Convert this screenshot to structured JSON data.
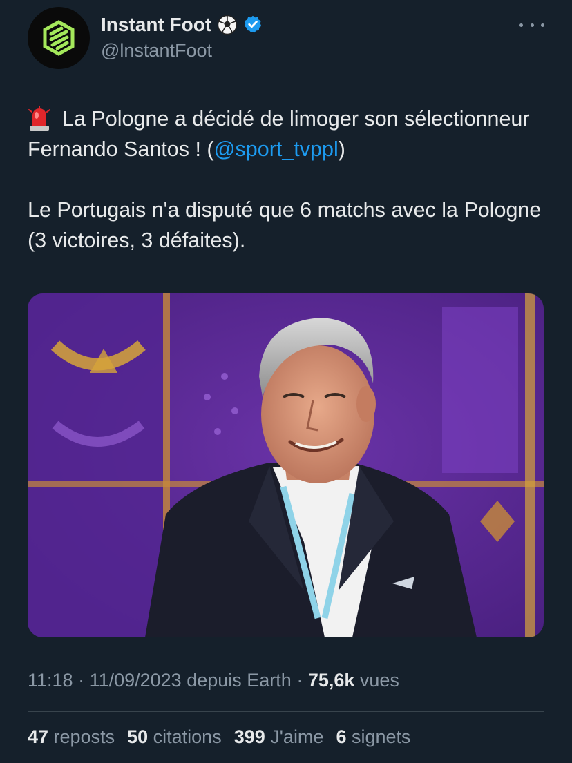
{
  "author": {
    "name": "Instant Foot",
    "name_emoji_icon": "soccer-ball-icon",
    "verified_icon": "verified-badge-icon",
    "handle": "@lnstantFoot",
    "avatar_icon": "instant-foot-logo",
    "brand_color": "#a4e85b"
  },
  "more_icon": "more-options-icon",
  "tweet": {
    "line1_icon": "rotating-light-icon",
    "p1_text": "La Pologne a décidé de limoger son sélectionneur Fernando Santos ! (",
    "mention": "@sport_tvppl",
    "p1_close": ")",
    "p2_text": "Le Portugais n'a disputé que 6 matchs avec la Pologne (3 victoires, 3 défaites).",
    "mention_color": "#1d9bf0"
  },
  "media": {
    "subject": "photo-fernando-santos",
    "background_color": "#5a2b91",
    "accent_color": "#d6a43a"
  },
  "meta": {
    "time": "11:18",
    "separator1": " · ",
    "date": "11/09/2023",
    "source": " depuis Earth",
    "separator2": " · ",
    "views_count": "75,6k",
    "views_label": " vues"
  },
  "stats": [
    {
      "count": "47",
      "label": " reposts"
    },
    {
      "count": "50",
      "label": " citations"
    },
    {
      "count": "399",
      "label": " J'aime"
    },
    {
      "count": "6",
      "label": " signets"
    }
  ],
  "colors": {
    "background": "#15202b",
    "text": "#e7e9ea",
    "muted": "#8b98a5",
    "divider": "#38444d"
  }
}
